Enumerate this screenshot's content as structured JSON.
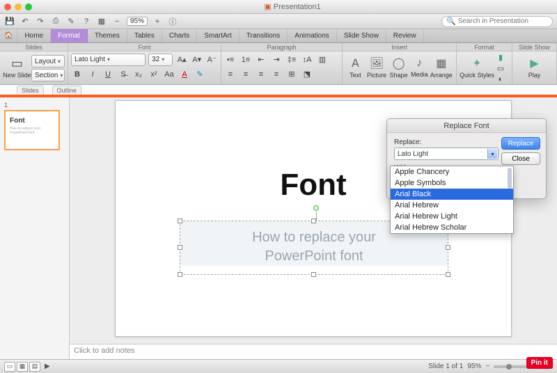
{
  "window": {
    "title": "Presentation1"
  },
  "qat": {
    "zoom": "95%",
    "search_placeholder": "Search in Presentation"
  },
  "tabs": {
    "items": [
      "Home",
      "Format",
      "Themes",
      "Tables",
      "Charts",
      "SmartArt",
      "Transitions",
      "Animations",
      "Slide Show",
      "Review"
    ],
    "active": "Format"
  },
  "group_heads": [
    "Slides",
    "Font",
    "Paragraph",
    "Insert",
    "Format",
    "Slide Show"
  ],
  "slides_group": {
    "new_slide": "New Slide",
    "layout": "Layout",
    "section": "Section"
  },
  "font_group": {
    "font_name": "Lato Light",
    "font_size": "32"
  },
  "insert_group": {
    "text": "Text",
    "picture": "Picture",
    "shape": "Shape",
    "media": "Media",
    "arrange": "Arrange"
  },
  "format_group": {
    "quick_styles": "Quick Styles"
  },
  "show_group": {
    "play": "Play"
  },
  "subtabs": {
    "slides": "Slides",
    "outline": "Outline"
  },
  "thumb": {
    "num": "1",
    "title": "Font",
    "sub": "How to replace your PowerPoint font"
  },
  "slide": {
    "title": "Font",
    "subtitle_l1": "How to replace your",
    "subtitle_l2": "PowerPoint font"
  },
  "notes": {
    "placeholder": "Click to add notes"
  },
  "status": {
    "slide": "Slide 1 of 1",
    "zoom": "95%"
  },
  "dialog": {
    "title": "Replace Font",
    "replace_label": "Replace:",
    "replace_value": "Lato Light",
    "with_label": "With:",
    "with_value": "Arial Black",
    "replace_btn": "Replace",
    "close_btn": "Close"
  },
  "dropdown": {
    "options": [
      "Apple Chancery",
      "Apple Symbols",
      "Arial Black",
      "Arial Hebrew",
      "Arial Hebrew Light",
      "Arial Hebrew Scholar"
    ],
    "selected": "Arial Black"
  },
  "pinit": "Pin it"
}
